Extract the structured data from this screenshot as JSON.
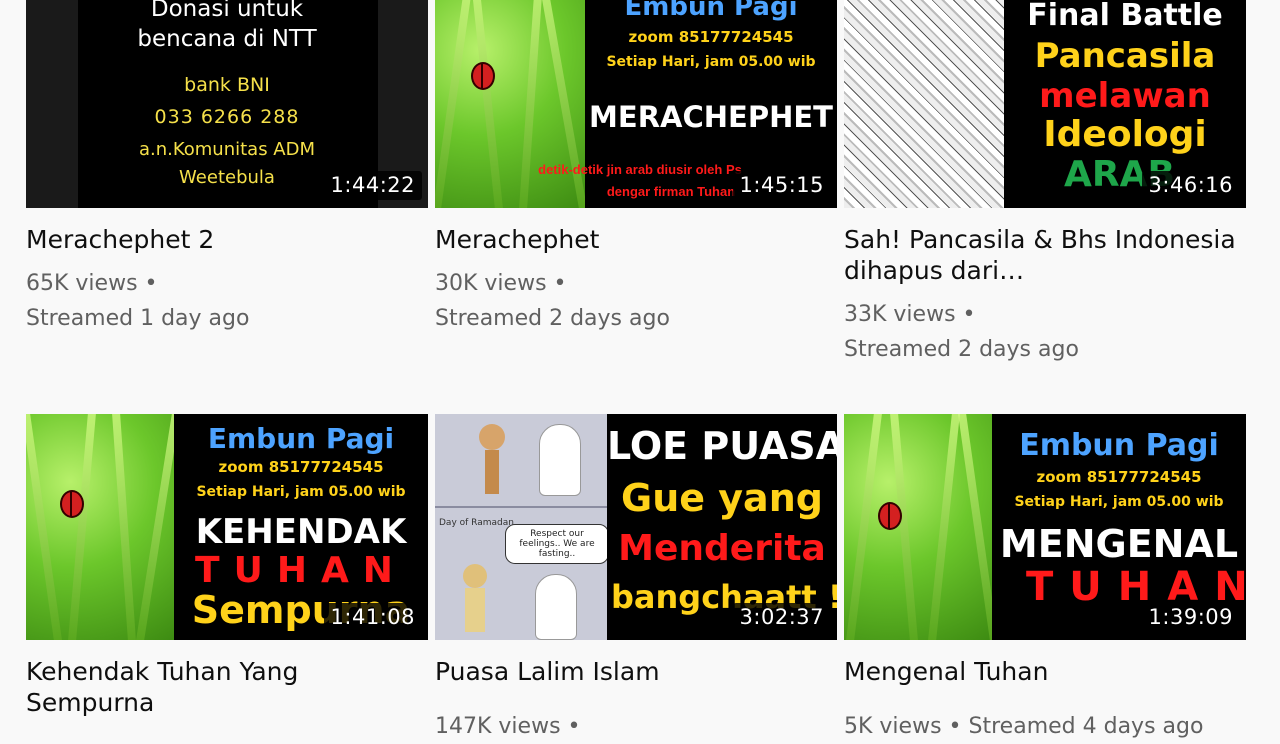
{
  "videos": [
    {
      "title": "Merachephet 2",
      "duration": "1:44:22",
      "views": "65K views",
      "streamed": "Streamed 1 day ago",
      "thumb": {
        "lines": [
          "Donasi untuk",
          "bencana di NTT",
          "bank BNI",
          "033 6266 288",
          "a.n.Komunitas ADM",
          "Weetebula"
        ]
      }
    },
    {
      "title": "Merachephet",
      "duration": "1:45:15",
      "views": "30K views",
      "streamed": "Streamed 2 days ago",
      "thumb": {
        "header": "Embun Pagi",
        "zoom": "zoom 85177724545",
        "schedule": "Setiap Hari, jam 05.00 wib",
        "main": "MERACHEPHET",
        "caption1": "detik-detik jin arab diusir oleh Ps",
        "caption2": "dengar firman Tuhan"
      }
    },
    {
      "title": "Sah! Pancasila & Bhs Indonesia dihapus dari…",
      "duration": "3:46:16",
      "views": "33K views",
      "streamed": "Streamed 2 days ago",
      "thumb": {
        "lines": [
          "Final Battle",
          "Pancasila",
          "melawan",
          "Ideologi",
          "ARAB"
        ]
      }
    },
    {
      "title": "Kehendak Tuhan Yang Sempurna",
      "duration": "1:41:08",
      "views": "",
      "streamed": "",
      "thumb": {
        "header": "Embun Pagi",
        "zoom": "zoom 85177724545",
        "schedule": "Setiap Hari, jam 05.00 wib",
        "main1": "KEHENDAK",
        "main2": "TUHAN",
        "main3": "Sempurna"
      }
    },
    {
      "title": "Puasa Lalim Islam",
      "duration": "3:02:37",
      "views": "147K views",
      "streamed": "",
      "thumb": {
        "lines": [
          "LOE PUASA",
          "Gue yang",
          "Menderita",
          "bangchaatt !"
        ],
        "bubble": "Respect our feelings.. We are fasting..",
        "caption": "Day of Ramadan"
      }
    },
    {
      "title": "Mengenal Tuhan",
      "duration": "1:39:09",
      "views": "5K views",
      "streamed": "Streamed 4 days ago",
      "thumb": {
        "header": "Embun Pagi",
        "zoom": "zoom 85177724545",
        "schedule": "Setiap Hari, jam 05.00 wib",
        "main1": "MENGENAL",
        "main2": "TUHAN"
      }
    }
  ],
  "separator": "•"
}
